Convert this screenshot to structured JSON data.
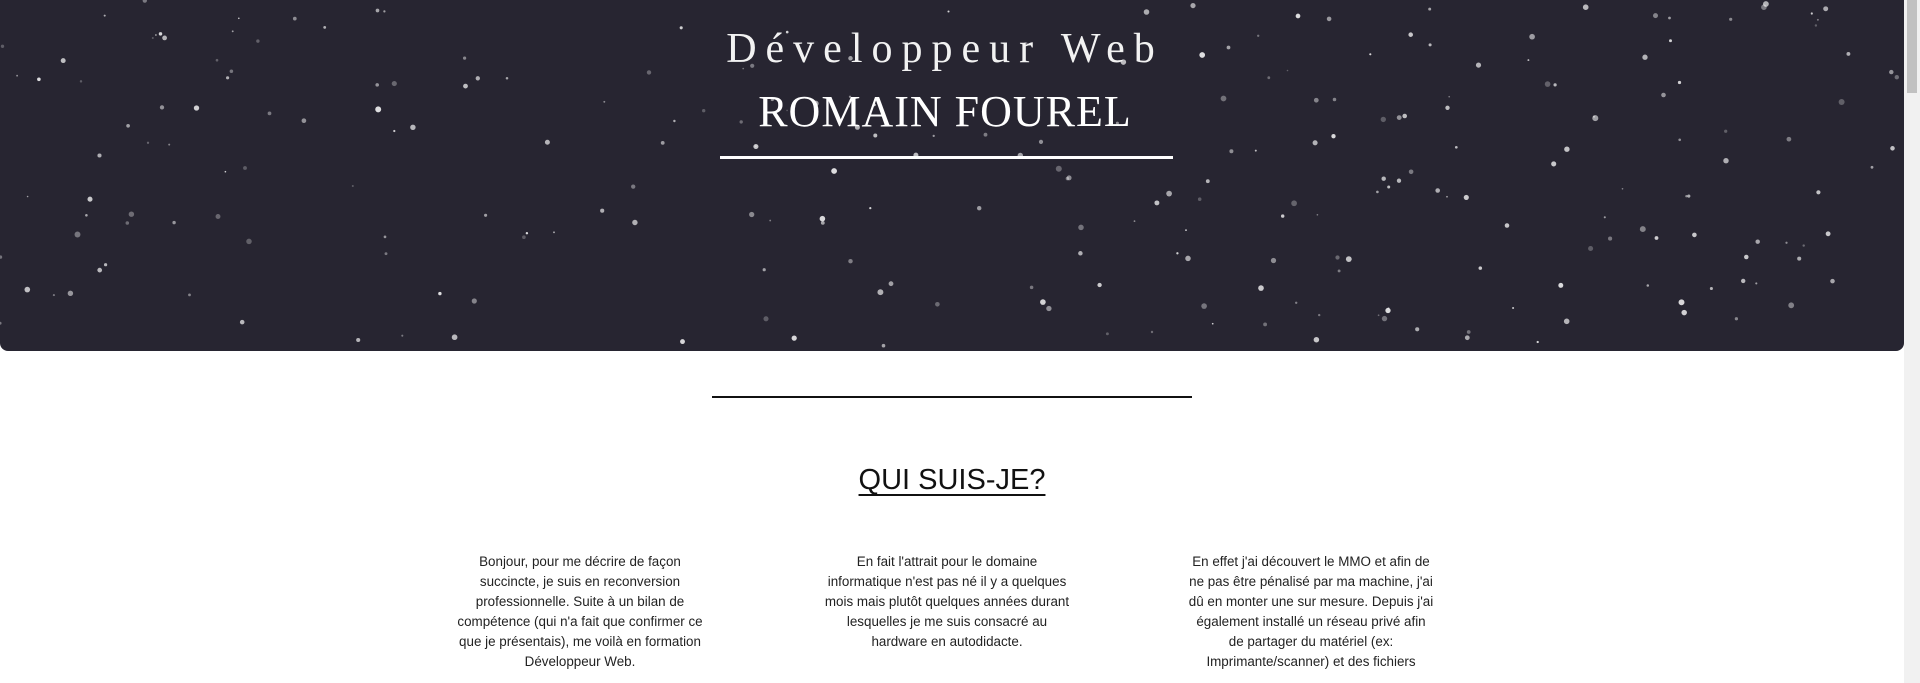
{
  "hero": {
    "subtitle": "Développeur Web",
    "title": "ROMAIN FOUREL"
  },
  "about": {
    "title": "QUI SUIS-JE?",
    "columns": [
      "Bonjour, pour me décrire de façon succincte, je suis en reconversion professionnelle. Suite à un bilan de compétence (qui n'a fait que confirmer ce que je présentais), me voilà en formation Développeur Web.",
      "En fait l'attrait pour le domaine informatique n'est pas né il y a quelques mois mais plutôt quelques années durant lesquelles je me suis consacré au hardware en autodidacte.",
      "En effet j'ai découvert le MMO et afin de ne pas être pénalisé par ma machine, j'ai dû en monter une sur mesure. Depuis j'ai également installé un réseau privé afin de partager du matériel (ex: Imprimante/scanner) et des fichiers"
    ]
  },
  "colors": {
    "hero_background": "#272531",
    "hero_text": "#ffffff",
    "body_text": "#222222"
  }
}
